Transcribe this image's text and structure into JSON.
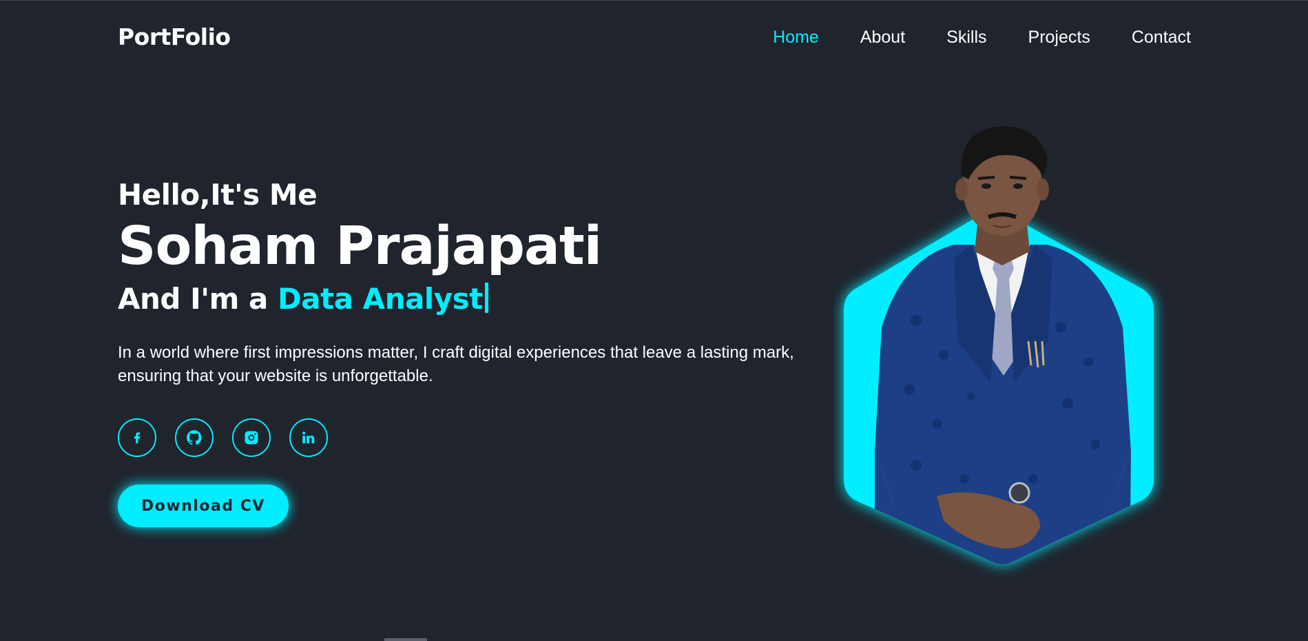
{
  "header": {
    "logo": "PortFolio",
    "nav": [
      "Home",
      "About",
      "Skills",
      "Projects",
      "Contact"
    ],
    "active_nav": "Home"
  },
  "hero": {
    "greeting": "Hello,It's Me",
    "name": "Soham Prajapati",
    "role_prefix": "And I'm a",
    "role_highlight": "Data Analyst",
    "description": "In a world where first impressions matter, I craft digital experiences that leave a lasting mark, ensuring that your website is unforgettable.",
    "socials": [
      {
        "icon": "facebook-icon"
      },
      {
        "icon": "github-icon"
      },
      {
        "icon": "instagram-icon"
      },
      {
        "icon": "linkedin-icon"
      }
    ],
    "cta_label": "Download CV"
  },
  "colors": {
    "background": "#1f242d",
    "accent": "#00eeff",
    "text": "#ffffff"
  }
}
